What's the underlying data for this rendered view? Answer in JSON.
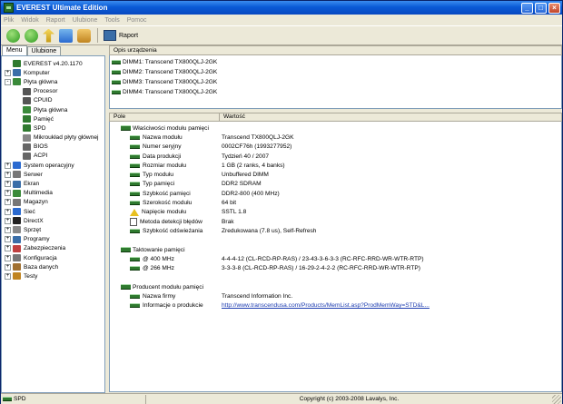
{
  "window": {
    "title": "EVEREST Ultimate Edition"
  },
  "menu": [
    "Plik",
    "Widok",
    "Raport",
    "Ulubione",
    "Tools",
    "Pomoc"
  ],
  "toolbar": {
    "report_label": "Raport"
  },
  "tabs": [
    "Menu",
    "Ulubione"
  ],
  "tree": [
    {
      "label": "EVEREST v4.20.1170",
      "level": 0,
      "exp": "",
      "icon": "everest-icon",
      "color": "#2f7a2f"
    },
    {
      "label": "Komputer",
      "level": 0,
      "exp": "+",
      "icon": "computer-icon",
      "color": "#3a6ea8"
    },
    {
      "label": "Płyta główna",
      "level": 0,
      "exp": "-",
      "icon": "motherboard-icon",
      "color": "#3a8a3a"
    },
    {
      "label": "Procesor",
      "level": 1,
      "exp": "",
      "icon": "cpu-icon",
      "color": "#555555"
    },
    {
      "label": "CPUID",
      "level": 1,
      "exp": "",
      "icon": "cpuid-icon",
      "color": "#555555"
    },
    {
      "label": "Płyta główna",
      "level": 1,
      "exp": "",
      "icon": "motherboard-icon",
      "color": "#3a8a3a"
    },
    {
      "label": "Pamięć",
      "level": 1,
      "exp": "",
      "icon": "memory-icon",
      "color": "#2f7a2f"
    },
    {
      "label": "SPD",
      "level": 1,
      "exp": "",
      "icon": "spd-icon",
      "color": "#2f7a2f"
    },
    {
      "label": "Mikroukład płyty głównej",
      "level": 1,
      "exp": "",
      "icon": "chipset-icon",
      "color": "#888888"
    },
    {
      "label": "BIOS",
      "level": 1,
      "exp": "",
      "icon": "bios-icon",
      "color": "#666666"
    },
    {
      "label": "ACPI",
      "level": 1,
      "exp": "",
      "icon": "acpi-icon",
      "color": "#666666"
    },
    {
      "label": "System operacyjny",
      "level": 0,
      "exp": "+",
      "icon": "os-icon",
      "color": "#2a6ad0"
    },
    {
      "label": "Serwer",
      "level": 0,
      "exp": "+",
      "icon": "server-icon",
      "color": "#777777"
    },
    {
      "label": "Ekran",
      "level": 0,
      "exp": "+",
      "icon": "display-icon",
      "color": "#3a6ea8"
    },
    {
      "label": "Multimedia",
      "level": 0,
      "exp": "+",
      "icon": "multimedia-icon",
      "color": "#3a8a3a"
    },
    {
      "label": "Magazyn",
      "level": 0,
      "exp": "+",
      "icon": "storage-icon",
      "color": "#777777"
    },
    {
      "label": "Sieć",
      "level": 0,
      "exp": "+",
      "icon": "network-icon",
      "color": "#2a6ad0"
    },
    {
      "label": "DirectX",
      "level": 0,
      "exp": "+",
      "icon": "directx-icon",
      "color": "#222222"
    },
    {
      "label": "Sprzęt",
      "level": 0,
      "exp": "+",
      "icon": "devices-icon",
      "color": "#888888"
    },
    {
      "label": "Programy",
      "level": 0,
      "exp": "+",
      "icon": "programs-icon",
      "color": "#3a6ea8"
    },
    {
      "label": "Zabezpieczenia",
      "level": 0,
      "exp": "+",
      "icon": "security-icon",
      "color": "#c04040"
    },
    {
      "label": "Konfiguracja",
      "level": 0,
      "exp": "+",
      "icon": "config-icon",
      "color": "#777777"
    },
    {
      "label": "Baza danych",
      "level": 0,
      "exp": "+",
      "icon": "database-icon",
      "color": "#a07030"
    },
    {
      "label": "Testy",
      "level": 0,
      "exp": "+",
      "icon": "benchmark-icon",
      "color": "#c08420"
    }
  ],
  "devices": {
    "header": "Opis urządzenia",
    "items": [
      "DIMM1: Transcend TX800QLJ-2GK",
      "DIMM2: Transcend TX800QLJ-2GK",
      "DIMM3: Transcend TX800QLJ-2GK",
      "DIMM4: Transcend TX800QLJ-2GK"
    ]
  },
  "details": {
    "col_field": "Pole",
    "col_value": "Wartość",
    "rows": [
      {
        "type": "section",
        "field": "Właściwości modułu pamięci",
        "value": ""
      },
      {
        "type": "item",
        "icon": "memory",
        "field": "Nazwa modułu",
        "value": "Transcend TX800QLJ-2GK"
      },
      {
        "type": "item",
        "icon": "memory",
        "field": "Numer seryjny",
        "value": "0002CF76h (1993277952)"
      },
      {
        "type": "item",
        "icon": "memory",
        "field": "Data produkcji",
        "value": "Tydzień 40 / 2007"
      },
      {
        "type": "item",
        "icon": "memory",
        "field": "Rozmiar modułu",
        "value": "1 GB (2 ranks, 4 banks)"
      },
      {
        "type": "item",
        "icon": "memory",
        "field": "Typ modułu",
        "value": "Unbuffered DIMM"
      },
      {
        "type": "item",
        "icon": "memory",
        "field": "Typ pamięci",
        "value": "DDR2 SDRAM"
      },
      {
        "type": "item",
        "icon": "memory",
        "field": "Szybkość pamięci",
        "value": "DDR2-800 (400 MHz)"
      },
      {
        "type": "item",
        "icon": "memory",
        "field": "Szerokość modułu",
        "value": "64 bit"
      },
      {
        "type": "item",
        "icon": "warning",
        "field": "Napięcie modułu",
        "value": "SSTL 1.8"
      },
      {
        "type": "item",
        "icon": "doc",
        "field": "Metoda detekcji błędów",
        "value": "Brak"
      },
      {
        "type": "item",
        "icon": "memory",
        "field": "Szybkość odświeżania",
        "value": "Zredukowana (7.8 us), Self-Refresh"
      },
      {
        "type": "gap",
        "field": "",
        "value": ""
      },
      {
        "type": "section",
        "field": "Taktowanie pamięci",
        "value": ""
      },
      {
        "type": "item",
        "icon": "memory",
        "field": "@ 400 MHz",
        "value": "4-4-4-12  (CL-RCD-RP-RAS) / 23-43-3-6-3-3  (RC-RFC-RRD-WR-WTR-RTP)"
      },
      {
        "type": "item",
        "icon": "memory",
        "field": "@ 266 MHz",
        "value": "3-3-3-8  (CL-RCD-RP-RAS) / 16-29-2-4-2-2  (RC-RFC-RRD-WR-WTR-RTP)"
      },
      {
        "type": "gap",
        "field": "",
        "value": ""
      },
      {
        "type": "section",
        "field": "Producent modułu pamięci",
        "value": ""
      },
      {
        "type": "item",
        "icon": "memory",
        "field": "Nazwa firmy",
        "value": "Transcend Information Inc."
      },
      {
        "type": "link",
        "icon": "memory",
        "field": "Informacje o produkcie",
        "value": "http://www.transcendusa.com/Products/MemList.asp?ProdMemWay=STD&L..."
      }
    ]
  },
  "status": {
    "left": "SPD",
    "right": "Copyright (c) 2003-2008 Lavalys, Inc."
  }
}
